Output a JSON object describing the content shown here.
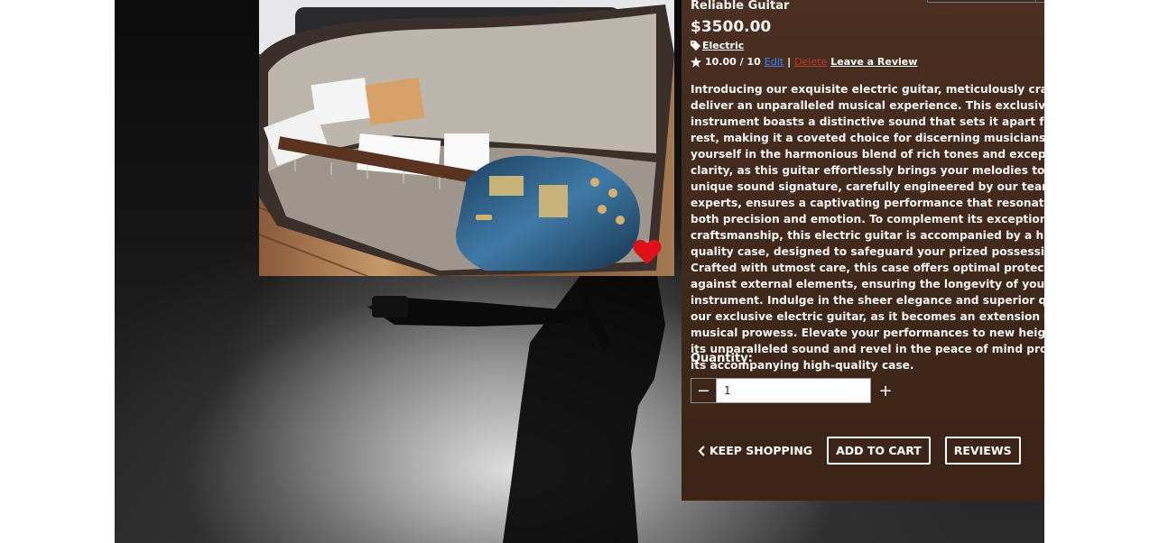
{
  "product": {
    "title_fragment": "Reliable Guitar",
    "price": "$3500.00",
    "category": "Electric",
    "rating": "10.00 / 10",
    "edit_label": "Edit",
    "delete_label": "Delete",
    "separator": "|",
    "leave_review_label": "Leave a Review",
    "description": "Introducing our exquisite electric guitar, meticulously crafted to deliver an unparalleled musical experience. This exclusive instrument boasts a distinctive sound that sets it apart from the rest, making it a coveted choice for discerning musicians. Immerse yourself in the harmonious blend of rich tones and exceptional clarity, as this guitar effortlessly brings your melodies to life. Its unique sound signature, carefully engineered by our team of experts, ensures a captivating performance that resonates with both precision and emotion. To complement its exceptional craftsmanship, this electric guitar is accompanied by a high-quality case, designed to safeguard your prized possession. Crafted with utmost care, this case offers optimal protection against external elements, ensuring the longevity of your instrument. Indulge in the sheer elegance and superior quality of our exclusive electric guitar, as it becomes an extension of your musical prowess. Elevate your performances to new heights with its unparalleled sound and revel in the peace of mind provided by its accompanying high-quality case."
  },
  "quantity": {
    "label": "Quantity:",
    "value": "1",
    "minus_symbol": "−",
    "plus_symbol": "+"
  },
  "actions": {
    "keep_shopping": "KEEP SHOPPING",
    "add_to_cart": "ADD TO CART",
    "reviews": "REVIEWS"
  },
  "colors": {
    "panel": "#4a2f22",
    "favorite": "#e0101b",
    "edit_link": "#3b82f6",
    "delete_link": "#c0392b"
  },
  "icons": {
    "category": "tag-icon",
    "rating": "star-icon",
    "favorite": "heart-icon",
    "keep_shopping": "chevron-left-icon"
  }
}
